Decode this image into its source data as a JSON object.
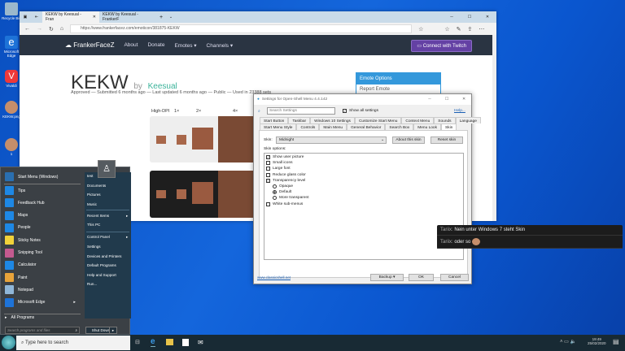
{
  "desktop": {
    "icons": [
      {
        "label": "Recycle Bin",
        "color": "#9bb8cc"
      },
      {
        "label": "Microsoft Edge",
        "color": "#1e73d8"
      },
      {
        "label": "Vivaldi",
        "color": "#ef3939"
      },
      {
        "label": "KEKW.png",
        "color": "#c58e6b"
      },
      {
        "label": "1",
        "color": "#c58e6b"
      }
    ]
  },
  "browser": {
    "tabs": [
      "KEKW by Keesual - Fran",
      "KEKW by Keesual - FrankerF"
    ],
    "new_tab": "+",
    "url": "https://www.frankerfacez.com/emoticon/381875-KEKW",
    "nav": {
      "brand": "FrankerFaceZ",
      "items": [
        "About",
        "Donate",
        "Emotes ▾",
        "Channels ▾"
      ],
      "connect": "Connect with Twitch"
    },
    "page": {
      "title": "KEKW",
      "by": "by",
      "author": "Keesual",
      "meta": "Approved — Submitted 6 months ago — Last updated 6 months ago — Public — Used in 23388 sets",
      "sizes": [
        "High-DPI",
        "1×",
        "2×",
        "4×"
      ],
      "sidebar": {
        "header": "Emote Options",
        "item": "Report Emote"
      }
    }
  },
  "settings": {
    "title": "Settings for Open-Shell Menu 4.4.142",
    "search_placeholder": "Search Settings",
    "show_all": "Show all settings",
    "help": "Help...",
    "tabs_row1": [
      "Start Button",
      "Taskbar",
      "Windows 10 Settings",
      "Customize Start Menu",
      "Context Menu",
      "Sounds",
      "Language"
    ],
    "tabs_row2": [
      "Start Menu Style",
      "Controls",
      "Main Menu",
      "General Behavior",
      "Search Box",
      "Menu Look",
      "Skin"
    ],
    "skin_label": "Skin:",
    "skin_value": "Midnight",
    "about_skin": "About this skin",
    "reset_skin": "Reset skin",
    "skin_options": "Skin options:",
    "options": [
      {
        "label": "Show user picture",
        "type": "check",
        "checked": true
      },
      {
        "label": "Small icons",
        "type": "check",
        "checked": false
      },
      {
        "label": "Large font",
        "type": "check",
        "checked": false
      },
      {
        "label": "Reduce glass color",
        "type": "check",
        "checked": false
      },
      {
        "label": "Transparency level",
        "type": "group"
      },
      {
        "label": "Opaque",
        "type": "radio",
        "checked": false
      },
      {
        "label": "Default",
        "type": "radio",
        "checked": true
      },
      {
        "label": "More transparent",
        "type": "radio",
        "checked": false
      },
      {
        "label": "White sub-menus",
        "type": "check",
        "checked": false
      }
    ],
    "link": "www.classicshell.net",
    "backup": "Backup",
    "ok": "OK",
    "cancel": "Cancel"
  },
  "startmenu": {
    "top_item": "Start Menu (Windows)",
    "left": [
      {
        "label": "Tips",
        "color": "#1e88e5"
      },
      {
        "label": "Feedback Hub",
        "color": "#1e88e5"
      },
      {
        "label": "Maps",
        "color": "#1e88e5"
      },
      {
        "label": "People",
        "color": "#1e88e5"
      },
      {
        "label": "Sticky Notes",
        "color": "#f2d23a"
      },
      {
        "label": "Snipping Tool",
        "color": "#c45a8f"
      },
      {
        "label": "Calculator",
        "color": "#1e88e5"
      },
      {
        "label": "Paint",
        "color": "#e8a33a"
      },
      {
        "label": "Notepad",
        "color": "#8fb6d8"
      },
      {
        "label": "Microsoft Edge",
        "color": "#1e73d8"
      }
    ],
    "all_programs": "All Programs",
    "search_placeholder": "Search programs and files",
    "right": [
      "test",
      "Documents",
      "Pictures",
      "Music",
      "Recent Items",
      "This PC",
      "Control Panel",
      "Settings",
      "Devices and Printers",
      "Default Programs",
      "Help and Support",
      "Run..."
    ],
    "shutdown": "Shut Down"
  },
  "taskbar": {
    "search_placeholder": "Type here to search",
    "time": "19:49",
    "date": "25/02/2020"
  },
  "chat": [
    {
      "user": "Tariix:",
      "text": "Nein unter Windows 7 steht Skin"
    },
    {
      "user": "Tariix:",
      "text": "oder so"
    }
  ]
}
